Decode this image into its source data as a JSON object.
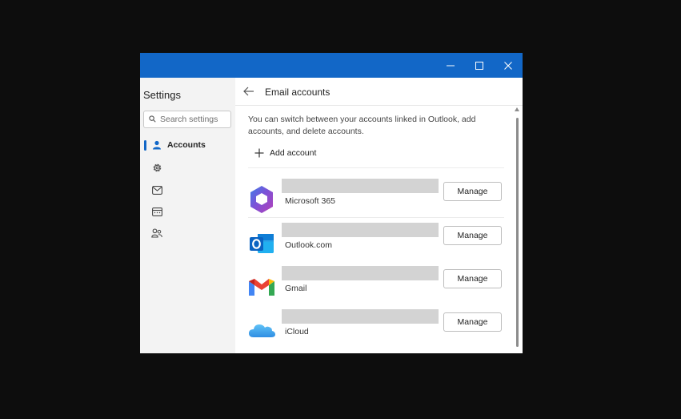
{
  "window": {
    "controls": {
      "minimize_icon": "minimize-icon",
      "maximize_icon": "maximize-icon",
      "close_icon": "close-icon"
    },
    "titlebar_color": "#1267c7"
  },
  "sidebar": {
    "title": "Settings",
    "search_placeholder": "Search settings",
    "items": [
      {
        "label": "Accounts",
        "icon": "person-icon",
        "active": true
      },
      {
        "label": "",
        "icon": "gear-icon"
      },
      {
        "label": "",
        "icon": "mail-icon"
      },
      {
        "label": "",
        "icon": "calendar-icon"
      },
      {
        "label": "",
        "icon": "people-icon"
      }
    ]
  },
  "main": {
    "title": "Email accounts",
    "description": "You can switch between your accounts linked in Outlook, add accounts, and delete accounts.",
    "add_account_label": "Add account",
    "accounts": [
      {
        "name": "Microsoft 365",
        "icon": "microsoft-365-icon",
        "action": "Manage"
      },
      {
        "name": "Outlook.com",
        "icon": "outlook-icon",
        "action": "Manage"
      },
      {
        "name": "Gmail",
        "icon": "gmail-icon",
        "action": "Manage"
      },
      {
        "name": "iCloud",
        "icon": "icloud-icon",
        "action": "Manage"
      }
    ]
  },
  "colors": {
    "accent": "#1267c7",
    "redacted": "#d3d3d3"
  }
}
